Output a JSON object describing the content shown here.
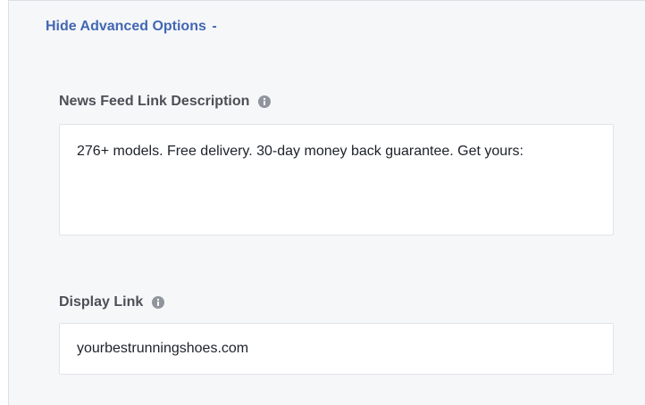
{
  "advanced": {
    "toggle_label": "Hide Advanced Options",
    "toggle_symbol": "-"
  },
  "news_feed_description": {
    "label": "News Feed Link Description",
    "info_icon": "info-icon",
    "value": "276+ models. Free delivery. 30-day money back guarantee. Get yours:"
  },
  "display_link": {
    "label": "Display Link",
    "info_icon": "info-icon",
    "value": "yourbestrunningshoes.com"
  },
  "colors": {
    "link": "#4267b2",
    "label": "#4b4f56",
    "panel_bg": "#f6f7f9",
    "input_border": "#e3e4e8"
  }
}
